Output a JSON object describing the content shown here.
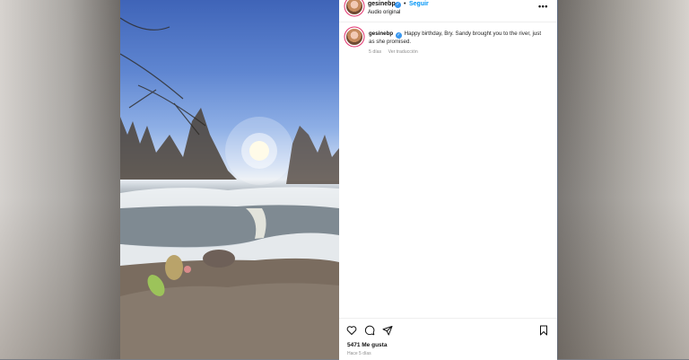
{
  "post": {
    "username": "gesinebp",
    "follow_label": "Seguir",
    "audio_label": "Audio original",
    "separator": "•",
    "more_label": "•••",
    "caption_text": "Happy birthday, Bry. Sandy brought you to the river, just as she promised.",
    "caption_age": "5 días",
    "see_translation": "Ver traducción",
    "likes": "5471 Me gusta",
    "posted": "Hace 5 días"
  },
  "colors": {
    "link_blue": "#0095f6",
    "verified_blue": "#3897f0",
    "muted_gray": "#8e8e8e"
  },
  "icons": {
    "like": "heart-icon",
    "comment": "comment-icon",
    "share": "send-icon",
    "save": "bookmark-icon",
    "verified": "verified-badge-icon",
    "more": "more-options-icon"
  }
}
